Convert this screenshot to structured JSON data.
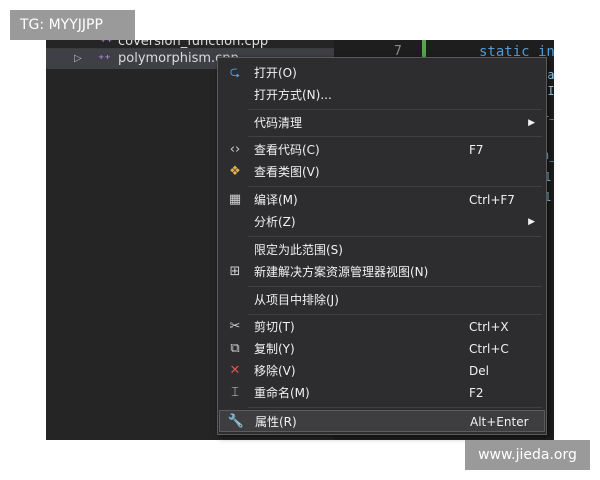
{
  "watermarks": {
    "top_left": "TG: MYYJJPP",
    "bottom_right": "www.jieda.org"
  },
  "tree": {
    "items": [
      {
        "label": "coversion_function.cpp",
        "icon": "cpp-file-icon"
      },
      {
        "label": "polymorphism.cpp",
        "icon": "cpp-file-icon",
        "selected": true
      }
    ]
  },
  "editor": {
    "line_number": "7",
    "code": "static in",
    "fragments": [
      "_a",
      "'I",
      "1_",
      "n_",
      "1",
      "1"
    ]
  },
  "menu": {
    "items": [
      {
        "label": "打开(O)",
        "icon": "open-arrow-icon",
        "shortcut": ""
      },
      {
        "label": "打开方式(N)...",
        "icon": "",
        "shortcut": ""
      },
      {
        "label": "代码清理",
        "icon": "",
        "shortcut": "",
        "submenu": true
      },
      {
        "label": "查看代码(C)",
        "icon": "code-brackets-icon",
        "shortcut": "F7"
      },
      {
        "label": "查看类图(V)",
        "icon": "class-diagram-icon",
        "shortcut": ""
      },
      {
        "label": "编译(M)",
        "icon": "compile-icon",
        "shortcut": "Ctrl+F7"
      },
      {
        "label": "分析(Z)",
        "icon": "",
        "shortcut": "",
        "submenu": true
      },
      {
        "label": "限定为此范围(S)",
        "icon": "",
        "shortcut": ""
      },
      {
        "label": "新建解决方案资源管理器视图(N)",
        "icon": "new-view-icon",
        "shortcut": ""
      },
      {
        "label": "从项目中排除(J)",
        "icon": "",
        "shortcut": ""
      },
      {
        "label": "剪切(T)",
        "icon": "scissors-icon",
        "shortcut": "Ctrl+X"
      },
      {
        "label": "复制(Y)",
        "icon": "copy-icon",
        "shortcut": "Ctrl+C"
      },
      {
        "label": "移除(V)",
        "icon": "remove-x-icon",
        "shortcut": "Del"
      },
      {
        "label": "重命名(M)",
        "icon": "rename-icon",
        "shortcut": "F2"
      },
      {
        "label": "属性(R)",
        "icon": "wrench-icon",
        "shortcut": "Alt+Enter",
        "highlighted": true
      }
    ]
  },
  "colors": {
    "menu_bg": "#2d2d30",
    "accent_blue": "#569cd6",
    "remove_red": "#e05252",
    "green_change": "#57a64a"
  }
}
